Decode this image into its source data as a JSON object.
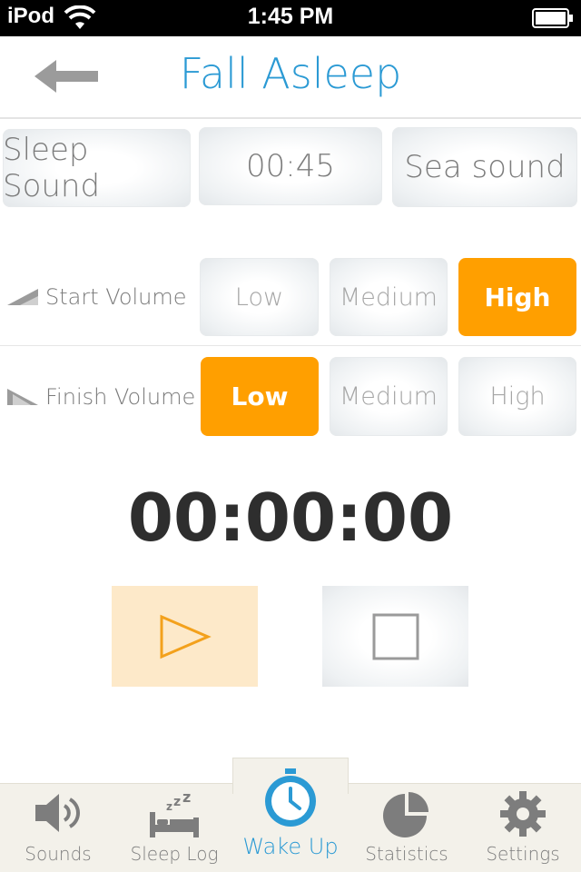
{
  "status_bar": {
    "carrier": "iPod",
    "time": "1:45 PM"
  },
  "header": {
    "title": "Fall Asleep"
  },
  "sound_row": {
    "sound_type": "Sleep Sound",
    "duration": "00:45",
    "sound_name": "Sea sound"
  },
  "start_volume": {
    "label": "Start Volume",
    "options": [
      "Low",
      "Medium",
      "High"
    ],
    "selected": "High"
  },
  "finish_volume": {
    "label": "Finish Volume",
    "options": [
      "Low",
      "Medium",
      "High"
    ],
    "selected": "Low"
  },
  "timer": {
    "value": "00:00:00"
  },
  "tabs": [
    {
      "label": "Sounds",
      "icon": "speaker-icon"
    },
    {
      "label": "Sleep Log",
      "icon": "bed-icon"
    },
    {
      "label": "Wake Up",
      "icon": "stopwatch-icon",
      "active": true
    },
    {
      "label": "Statistics",
      "icon": "pie-chart-icon"
    },
    {
      "label": "Settings",
      "icon": "gear-icon"
    }
  ],
  "colors": {
    "accent": "#2b9ad4",
    "selected": "#ff9f00",
    "play_bg": "#fde9c9",
    "tab_bar": "#f3f1ea"
  }
}
